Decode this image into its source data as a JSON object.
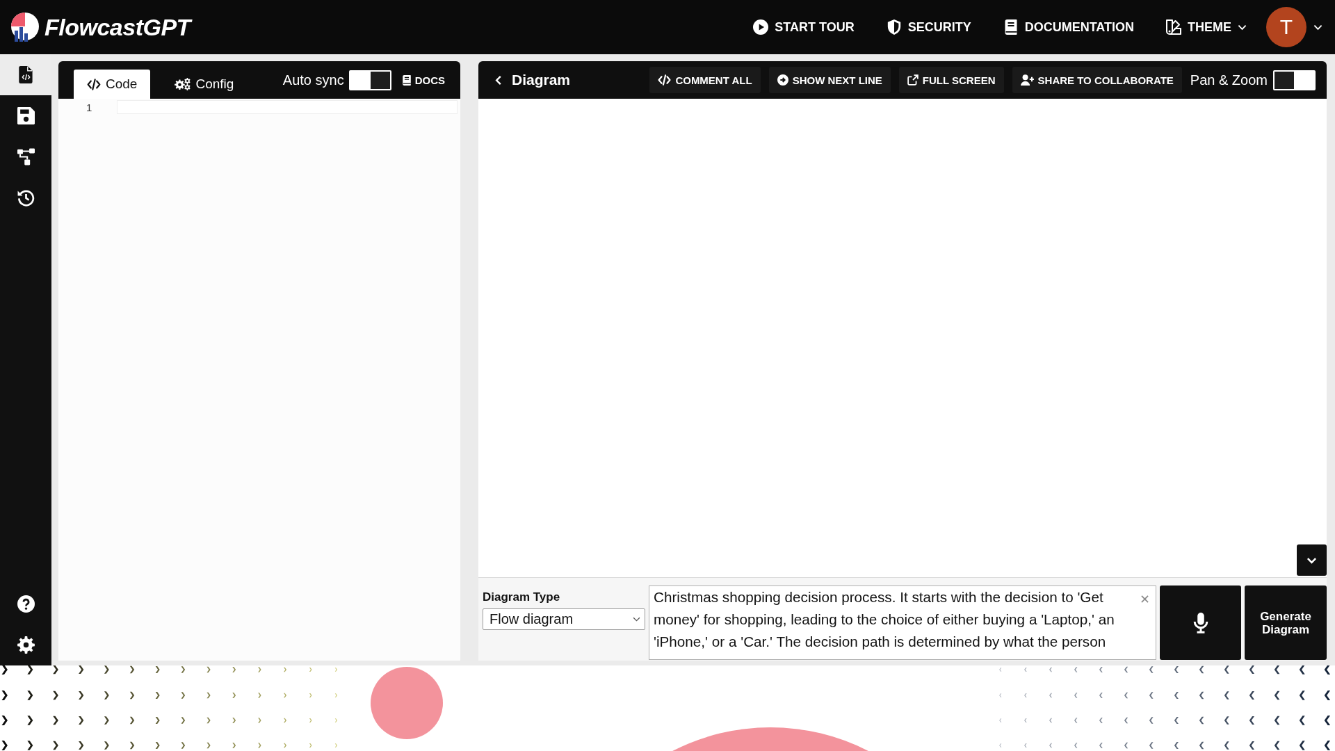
{
  "header": {
    "logo": "FlowcastGPT",
    "nav": [
      {
        "label": "START TOUR",
        "has_menu": false
      },
      {
        "label": "SECURITY",
        "has_menu": false
      },
      {
        "label": "DOCUMENTATION",
        "has_menu": false
      },
      {
        "label": "THEME",
        "has_menu": true
      }
    ],
    "avatar": {
      "initial": "T",
      "has_menu": true
    }
  },
  "sidebar": {
    "items": [
      {
        "selected": true
      },
      {
        "selected": false
      },
      {
        "selected": false
      },
      {
        "selected": false
      }
    ],
    "bottom_items": [
      {
        "selected": false
      },
      {
        "selected": false
      }
    ]
  },
  "editor": {
    "tabs": [
      {
        "label": "Code",
        "selected": true
      },
      {
        "label": "Config",
        "selected": false
      }
    ],
    "auto_sync": {
      "label": "Auto sync",
      "on": true
    },
    "docs_button": "DOCS",
    "line_numbers": [
      "1"
    ]
  },
  "diagram": {
    "title": "Diagram",
    "actions": [
      "COMMENT ALL",
      "SHOW NEXT LINE",
      "FULL SCREEN",
      "SHARE TO COLLABORATE"
    ],
    "pan_zoom": {
      "label": "Pan & Zoom",
      "on": false
    },
    "prompt": {
      "diagram_type": {
        "label": "Diagram Type",
        "value": "Flow diagram"
      },
      "description": "Christmas shopping decision process. It starts with the decision to 'Get money' for shopping, leading to the choice of either buying a 'Laptop,' an 'iPhone,' or a 'Car.' The decision path is determined by what the person",
      "generate_button": "Generate Diagram"
    }
  }
}
